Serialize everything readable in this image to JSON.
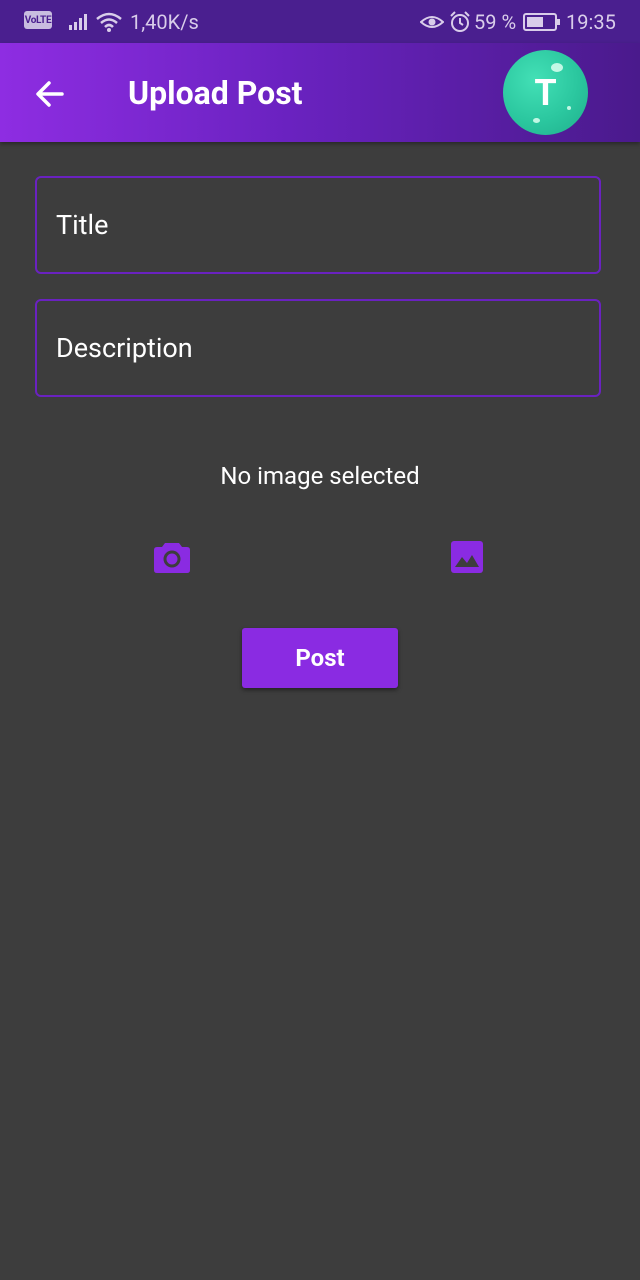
{
  "status_bar": {
    "network_badge": "VoLTE",
    "speed": "1,40K/s",
    "battery": "59 %",
    "time": "19:35",
    "icons": [
      "signal-icon",
      "wifi-icon",
      "eye-icon",
      "alarm-icon",
      "battery-icon"
    ]
  },
  "app_bar": {
    "title": "Upload Post",
    "avatar_letter": "T",
    "back_icon": "arrow-back-icon"
  },
  "form": {
    "title_placeholder": "Title",
    "description_placeholder": "Description",
    "title_value": "",
    "description_value": ""
  },
  "image": {
    "status": "No image selected",
    "camera_icon": "camera-icon",
    "gallery_icon": "image-icon"
  },
  "actions": {
    "post_label": "Post"
  },
  "colors": {
    "background": "#3d3d3d",
    "status_bar": "#4a1f8f",
    "accent": "#8a2be2",
    "field_border": "#6a22c0",
    "avatar": "#2bc79f"
  }
}
